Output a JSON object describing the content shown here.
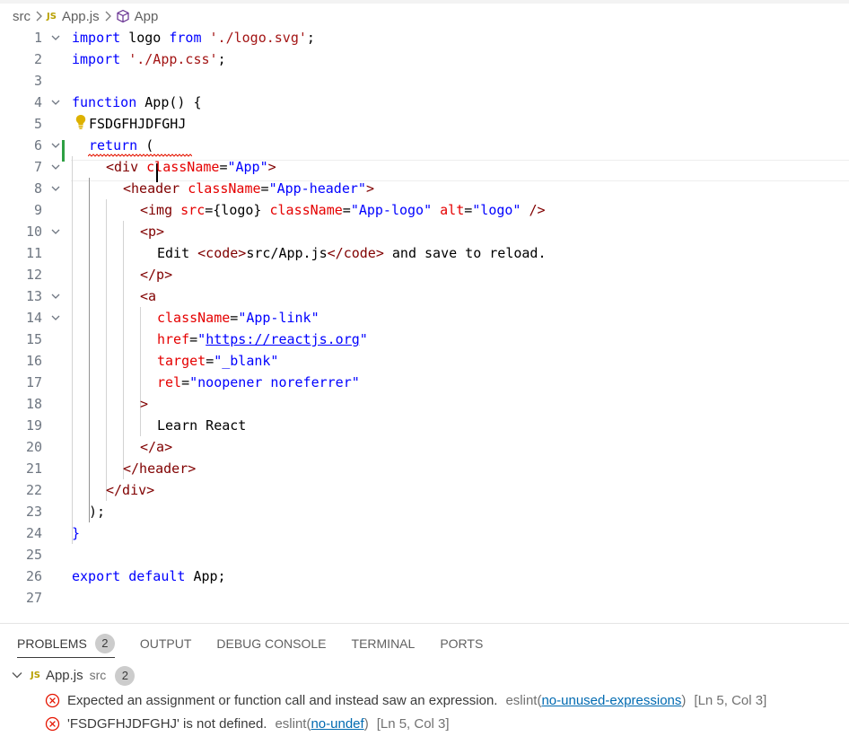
{
  "breadcrumb": {
    "folder": "src",
    "file_badge": "JS",
    "file": "App.js",
    "symbol": "App"
  },
  "editor": {
    "lines": [
      {
        "n": "1"
      },
      {
        "n": "2"
      },
      {
        "n": "3"
      },
      {
        "n": "4"
      },
      {
        "n": "5"
      },
      {
        "n": "6"
      },
      {
        "n": "7"
      },
      {
        "n": "8"
      },
      {
        "n": "9"
      },
      {
        "n": "10"
      },
      {
        "n": "11"
      },
      {
        "n": "12"
      },
      {
        "n": "13"
      },
      {
        "n": "14"
      },
      {
        "n": "15"
      },
      {
        "n": "16"
      },
      {
        "n": "17"
      },
      {
        "n": "18"
      },
      {
        "n": "19"
      },
      {
        "n": "20"
      },
      {
        "n": "21"
      },
      {
        "n": "22"
      },
      {
        "n": "23"
      },
      {
        "n": "24"
      },
      {
        "n": "25"
      },
      {
        "n": "26"
      },
      {
        "n": "27"
      }
    ],
    "tokens": {
      "l1_import": "import",
      "l1_ident": " logo ",
      "l1_from": "from",
      "l1_str": " './logo.svg'",
      "l1_end": ";",
      "l2_import": "import",
      "l2_str": " './App.css'",
      "l2_end": ";",
      "l4_function": "function",
      "l4_rest": " App() {",
      "l5_text": "FSDGFHJDFGHJ",
      "l6_return": "return",
      "l6_paren": " (",
      "l7_open": "<div",
      "l7_attr": " className",
      "l7_eq": "=",
      "l7_val": "\"App\"",
      "l7_close": ">",
      "l8_open": "<header",
      "l8_attr": " className",
      "l8_eq": "=",
      "l8_val": "\"App-header\"",
      "l8_close": ">",
      "l9_open": "<img",
      "l9_attr1": " src",
      "l9_eq1": "=",
      "l9_expr": "{logo}",
      "l9_attr2": " className",
      "l9_eq2": "=",
      "l9_val2": "\"App-logo\"",
      "l9_attr3": " alt",
      "l9_eq3": "=",
      "l9_val3": "\"logo\"",
      "l9_close": " />",
      "l10_tag": "<p>",
      "l11_t1": "Edit ",
      "l11_code_open": "<code>",
      "l11_path": "src/App.js",
      "l11_code_close": "</code>",
      "l11_t2": " and save to reload.",
      "l12_tag": "</p>",
      "l13_tag": "<a",
      "l14_attr": "className",
      "l14_eq": "=",
      "l14_val": "\"App-link\"",
      "l15_attr": "href",
      "l15_eq": "=",
      "l15_q1": "\"",
      "l15_url": "https://reactjs.org",
      "l15_q2": "\"",
      "l16_attr": "target",
      "l16_eq": "=",
      "l16_val": "\"_blank\"",
      "l17_attr": "rel",
      "l17_eq": "=",
      "l17_val": "\"noopener noreferrer\"",
      "l18_tag": ">",
      "l19_text": "Learn React",
      "l20_tag": "</a>",
      "l21_tag": "</header>",
      "l22_tag": "</div>",
      "l23_text": ");",
      "l24_text": "}",
      "l26_export": "export",
      "l26_default": " default",
      "l26_rest": " App;"
    }
  },
  "panel": {
    "tabs": [
      {
        "label": "PROBLEMS",
        "badge": "2"
      },
      {
        "label": "OUTPUT"
      },
      {
        "label": "DEBUG CONSOLE"
      },
      {
        "label": "TERMINAL"
      },
      {
        "label": "PORTS"
      }
    ],
    "group": {
      "badge": "JS",
      "file": "App.js",
      "path": "src",
      "count": "2"
    },
    "problems": [
      {
        "message": "Expected an assignment or function call and instead saw an expression.",
        "source": "eslint(",
        "rule": "no-unused-expressions",
        "source_end": ")",
        "location": "[Ln 5, Col 3]"
      },
      {
        "message": "'FSDGFHJDFGHJ' is not defined.",
        "source": "eslint(",
        "rule": "no-undef",
        "source_end": ")",
        "location": "[Ln 5, Col 3]"
      }
    ]
  },
  "colors": {
    "keyword": "#0000ff",
    "string": "#a31515",
    "tag": "#800000",
    "attribute": "#e50000",
    "error": "#e51400",
    "link": "#006ab1",
    "modified_gutter": "#2ea043"
  }
}
